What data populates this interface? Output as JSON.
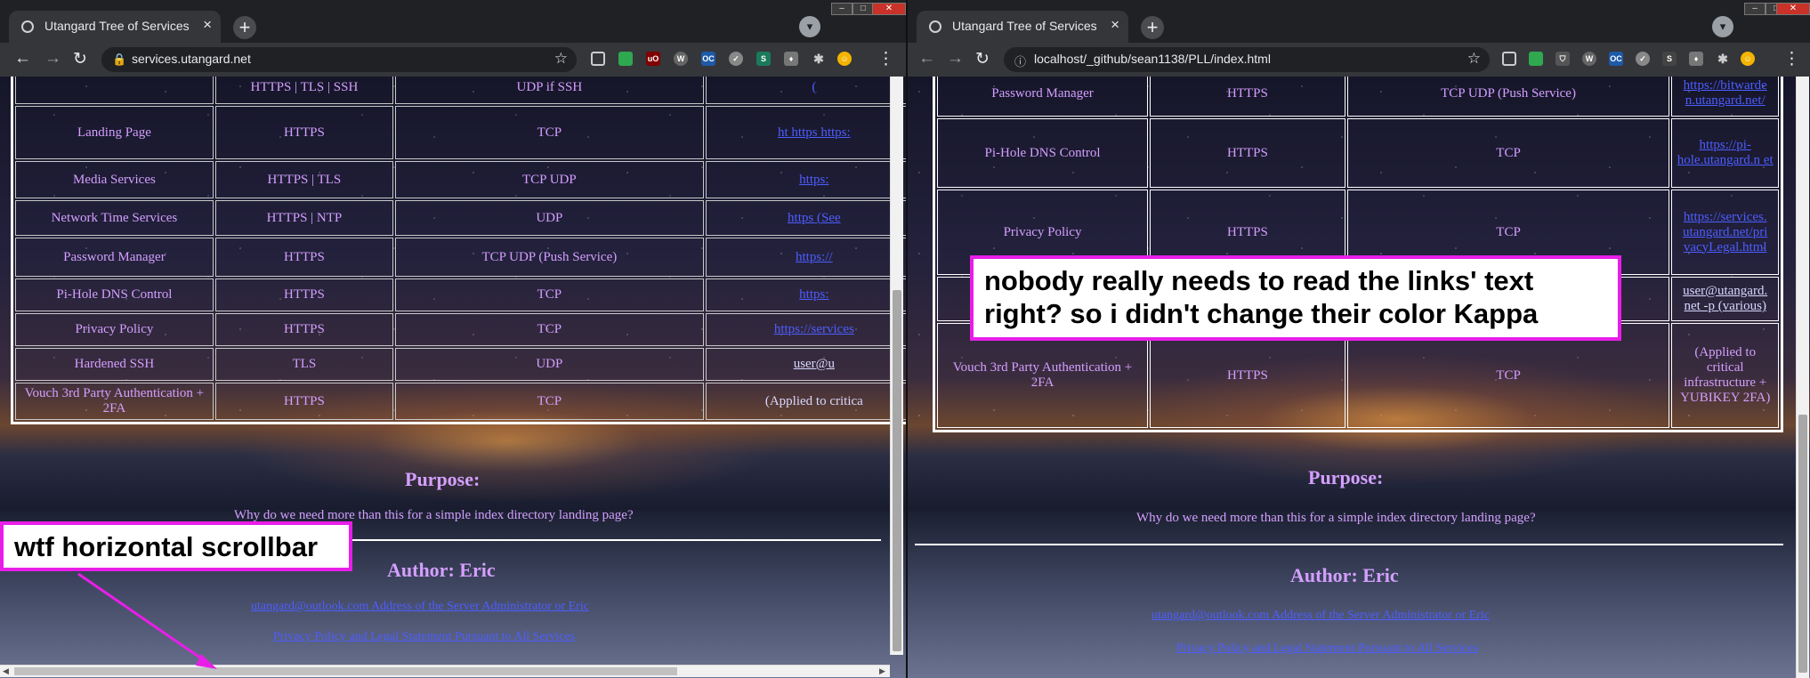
{
  "left_window": {
    "tab_title": "Utangard Tree of Services",
    "url": "services.utangard.net",
    "table_rows": [
      {
        "service": "",
        "protocol": "HTTPS | TLS | SSH",
        "transport": "UDP if SSH",
        "link": "("
      },
      {
        "service": "Landing Page",
        "protocol": "HTTPS",
        "transport": "TCP",
        "link": "ht https https:"
      },
      {
        "service": "Media Services",
        "protocol": "HTTPS | TLS",
        "transport": "TCP UDP",
        "link": "https:"
      },
      {
        "service": "Network Time Services",
        "protocol": "HTTPS | NTP",
        "transport": "UDP",
        "link": "https (See"
      },
      {
        "service": "Password Manager",
        "protocol": "HTTPS",
        "transport": "TCP UDP (Push Service)",
        "link": "https://"
      },
      {
        "service": "Pi-Hole DNS Control",
        "protocol": "HTTPS",
        "transport": "TCP",
        "link": "https:"
      },
      {
        "service": "Privacy Policy",
        "protocol": "HTTPS",
        "transport": "TCP",
        "link": "https://services"
      },
      {
        "service": "Hardened SSH",
        "protocol": "TLS",
        "transport": "UDP",
        "link": "user@u"
      },
      {
        "service": "Vouch 3rd Party Authentication + 2FA",
        "protocol": "HTTPS",
        "transport": "TCP",
        "link": "(Applied to critica"
      }
    ],
    "purpose_heading": "Purpose:",
    "purpose_text": "Why do we need more than this for a simple index directory landing page?",
    "author_heading": "Author: Eric",
    "author_link": "utangard@outlook.com Address of the Server Administrator or Eric",
    "privacy_link": "Privacy Policy and Legal Statement Pursuant to All Services"
  },
  "right_window": {
    "tab_title": "Utangard Tree of Services",
    "url": "localhost/_github/sean1138/PLL/index.html",
    "table_rows": [
      {
        "service": "Password Manager",
        "protocol": "HTTPS",
        "transport": "TCP UDP (Push Service)",
        "link": "https://bitwarde n.utangard.net/"
      },
      {
        "service": "Pi-Hole DNS Control",
        "protocol": "HTTPS",
        "transport": "TCP",
        "link": "https://pi-hole.utangard.n et"
      },
      {
        "service": "Privacy Policy",
        "protocol": "HTTPS",
        "transport": "TCP",
        "link": "https://services. utangard.net/pri vacyLegal.html"
      },
      {
        "service": "",
        "protocol": "",
        "transport": "",
        "link": "user@utangard. net -p (various)"
      },
      {
        "service": "Vouch 3rd Party Authentication + 2FA",
        "protocol": "HTTPS",
        "transport": "TCP",
        "link": "(Applied to critical infrastructure + YUBIKEY 2FA)"
      }
    ],
    "purpose_heading": "Purpose:",
    "purpose_text": "Why do we need more than this for a simple index directory landing page?",
    "author_heading": "Author: Eric",
    "author_link": "utangard@outlook.com Address of the Server Administrator or Eric",
    "privacy_link": "Privacy Policy and Legal Statement Pursuant to All Services"
  },
  "annotations": {
    "left": "wtf horizontal scrollbar",
    "right": "nobody really needs to read the links' text right?  so i didn't change their color Kappa"
  },
  "colors": {
    "text": "#d49fff",
    "link": "#4d5dff",
    "annotation_border": "#e81ee8"
  }
}
